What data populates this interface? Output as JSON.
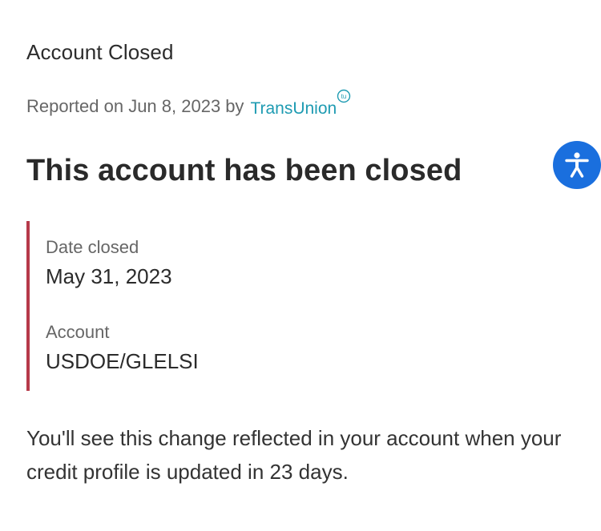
{
  "section_title": "Account Closed",
  "report": {
    "reported_on": "Reported on Jun 8, 2023",
    "by": "by",
    "bureau": "TransUnion",
    "bureau_mark": "tu",
    "bureau_color": "#1e9bb2"
  },
  "headline": "This account has been closed",
  "details": {
    "accent_color": "#b63a4a",
    "date_closed_label": "Date closed",
    "date_closed_value": "May 31, 2023",
    "account_label": "Account",
    "account_value": "USDOE/GLELSI"
  },
  "note": "You'll see this change reflected in your account when your credit profile is updated in 23 days.",
  "accessibility_button": {
    "icon": "accessibility-icon",
    "color": "#1a6fde"
  }
}
